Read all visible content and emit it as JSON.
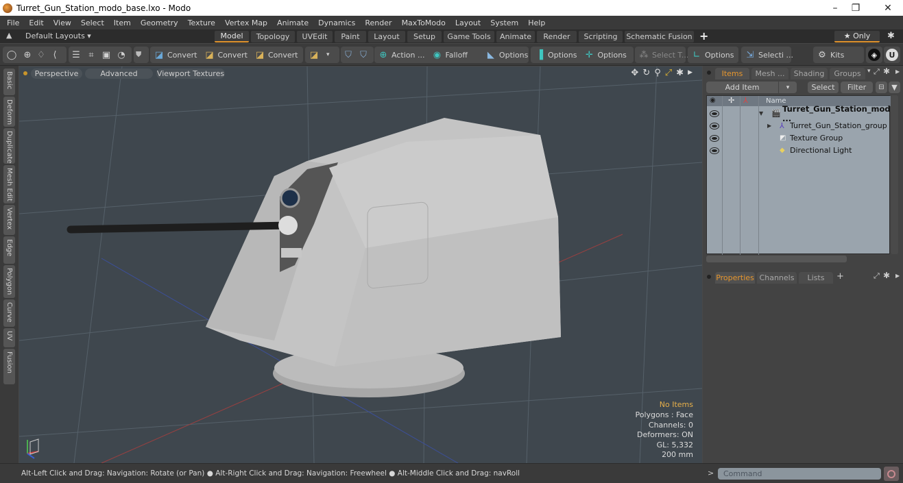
{
  "window": {
    "title": "Turret_Gun_Station_modo_base.lxo - Modo",
    "controls": {
      "minimize": "–",
      "restore": "❐",
      "close": "✕"
    }
  },
  "menu": [
    "File",
    "Edit",
    "View",
    "Select",
    "Item",
    "Geometry",
    "Texture",
    "Vertex Map",
    "Animate",
    "Dynamics",
    "Render",
    "MaxToModo",
    "Layout",
    "System",
    "Help"
  ],
  "layoutbar": {
    "layouts_label": "Default Layouts ▾",
    "tabs": [
      "Model",
      "Topology",
      "UVEdit",
      "Paint",
      "Layout",
      "Setup",
      "Game Tools",
      "Animate",
      "Render",
      "Scripting",
      "Schematic Fusion"
    ],
    "active_tab": "Model",
    "add_label": "+",
    "only_label": "★ Only",
    "settings_icon": "gear-icon"
  },
  "toolbar": {
    "convert_labels": [
      "Convert",
      "Convert",
      "Convert"
    ],
    "action_label": "Action ...",
    "falloff_label": "Falloff",
    "options_labels": [
      "Options",
      "Options",
      "Options",
      "Options"
    ],
    "select_t_label": "Select T...",
    "selecti_label": "Selecti ...",
    "kits_label": "Kits"
  },
  "left_tabs": [
    "Basic",
    "Deform",
    "Duplicate",
    "Mesh Edit",
    "Vertex",
    "Edge",
    "Polygon",
    "Curve",
    "UV",
    "Fusion"
  ],
  "viewport": {
    "buttons": [
      "Perspective",
      "Advanced",
      "Viewport Textures"
    ],
    "hud": {
      "selection": "No Items",
      "polygons": "Polygons : Face",
      "channels": "Channels: 0",
      "deformers": "Deformers: ON",
      "gl": "GL: 5,332",
      "scale": "200 mm"
    },
    "accent_color": "#e8b04a",
    "background_color": "#3f474e"
  },
  "items_panel": {
    "tabs": [
      "Items",
      "Mesh ...",
      "Shading",
      "Groups"
    ],
    "active_tab": "Items",
    "add_item_label": "Add Item",
    "select_label": "Select",
    "filter_label": "Filter",
    "column_name": "Name",
    "items": [
      {
        "name": "Turret_Gun_Station_mod ...",
        "icon": "scene-icon",
        "bold": true
      },
      {
        "name": "Turret_Gun_Station_group",
        "icon": "group-locator-icon",
        "bold": false
      },
      {
        "name": "Texture Group",
        "icon": "texture-group-icon",
        "bold": false
      },
      {
        "name": "Directional Light",
        "icon": "directional-light-icon",
        "bold": false
      }
    ]
  },
  "properties_panel": {
    "tabs": [
      "Properties",
      "Channels",
      "Lists"
    ],
    "active_tab": "Properties",
    "add_label": "+"
  },
  "status": {
    "hint_1": "Alt-Left Click and Drag: Navigation: Rotate (or Pan)",
    "hint_2": "Alt-Right Click and Drag: Navigation: Freewheel",
    "hint_3": "Alt-Middle Click and Drag: navRoll",
    "command_prompt": ">",
    "command_placeholder": "Command"
  }
}
